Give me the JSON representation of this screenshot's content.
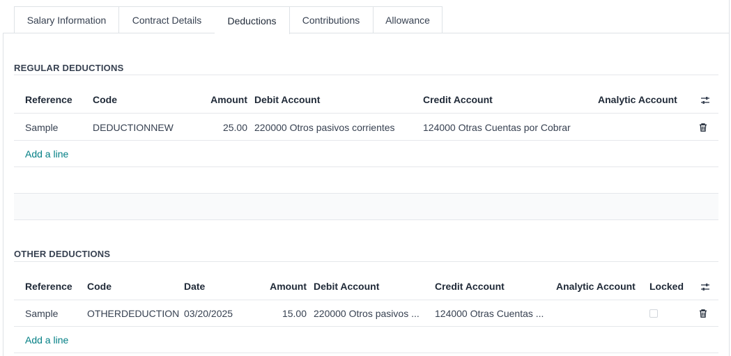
{
  "tabs": [
    {
      "label": "Salary Information"
    },
    {
      "label": "Contract Details"
    },
    {
      "label": "Deductions"
    },
    {
      "label": "Contributions"
    },
    {
      "label": "Allowance"
    }
  ],
  "active_tab": "Deductions",
  "regular": {
    "title": "REGULAR DEDUCTIONS",
    "columns": [
      "Reference",
      "Code",
      "Amount",
      "Debit Account",
      "Credit Account",
      "Analytic Account"
    ],
    "rows": [
      {
        "reference": "Sample",
        "code": "DEDUCTIONNEW",
        "amount": "25.00",
        "debit": "220000 Otros pasivos corrientes",
        "credit": "124000 Otras Cuentas por Cobrar",
        "analytic": ""
      }
    ],
    "add_line": "Add a line"
  },
  "other": {
    "title": "OTHER DEDUCTIONS",
    "columns": [
      "Reference",
      "Code",
      "Date",
      "Amount",
      "Debit Account",
      "Credit Account",
      "Analytic Account",
      "Locked"
    ],
    "rows": [
      {
        "reference": "Sample",
        "code": "OTHERDEDUCTION",
        "date": "03/20/2025",
        "amount": "15.00",
        "debit": "220000 Otros pasivos ...",
        "credit": "124000 Otras Cuentas ...",
        "analytic": "",
        "locked": false
      }
    ],
    "add_line": "Add a line"
  },
  "icons": {
    "column_settings": "sliders-icon",
    "delete": "trash-icon"
  },
  "colors": {
    "link": "#017e84",
    "border": "#dee2e6"
  }
}
